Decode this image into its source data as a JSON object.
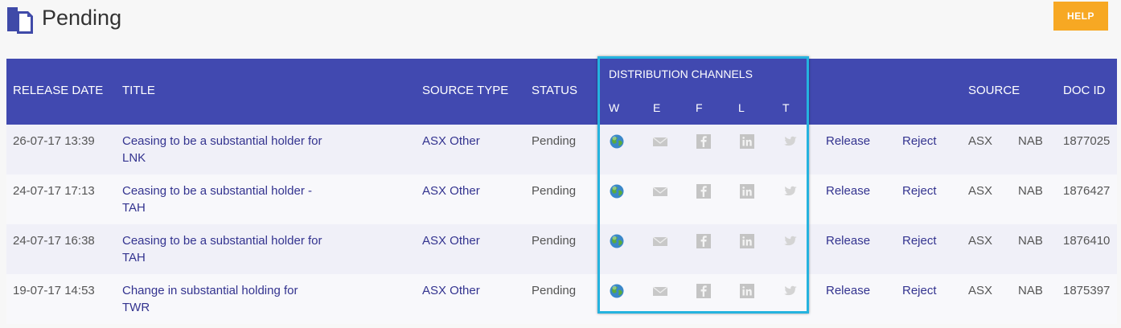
{
  "page": {
    "title": "Pending",
    "help_label": "HELP"
  },
  "table": {
    "headers": {
      "release_date": "RELEASE DATE",
      "title": "TITLE",
      "source_type": "SOURCE TYPE",
      "status": "STATUS",
      "distribution_channels": "DISTRIBUTION CHANNELS",
      "source": "SOURCE",
      "doc_id": "DOC ID"
    },
    "channel_letters": [
      "W",
      "E",
      "F",
      "L",
      "T"
    ],
    "channel_icons": [
      "globe-icon",
      "email-icon",
      "facebook-icon",
      "linkedin-icon",
      "twitter-icon"
    ],
    "rows": [
      {
        "release_date": "26-07-17 13:39",
        "title_line1": "Ceasing to be a substantial holder for",
        "title_line2": "LNK",
        "source_type": "ASX Other",
        "status": "Pending",
        "release": "Release",
        "reject": "Reject",
        "source": "ASX",
        "entity": "NAB",
        "doc_id": "1877025"
      },
      {
        "release_date": "24-07-17 17:13",
        "title_line1": "Ceasing to be a substantial holder -",
        "title_line2": "TAH",
        "source_type": "ASX Other",
        "status": "Pending",
        "release": "Release",
        "reject": "Reject",
        "source": "ASX",
        "entity": "NAB",
        "doc_id": "1876427"
      },
      {
        "release_date": "24-07-17 16:38",
        "title_line1": "Ceasing to be a substantial holder for",
        "title_line2": "TAH",
        "source_type": "ASX Other",
        "status": "Pending",
        "release": "Release",
        "reject": "Reject",
        "source": "ASX",
        "entity": "NAB",
        "doc_id": "1876410"
      },
      {
        "release_date": "19-07-17 14:53",
        "title_line1": "Change in substantial holding for",
        "title_line2": "TWR",
        "source_type": "ASX Other",
        "status": "Pending",
        "release": "Release",
        "reject": "Reject",
        "source": "ASX",
        "entity": "NAB",
        "doc_id": "1875397"
      }
    ]
  },
  "colors": {
    "header_bg": "#4149b0",
    "help_bg": "#f7a823",
    "highlight_border": "#25b3df",
    "link": "#33338f"
  }
}
